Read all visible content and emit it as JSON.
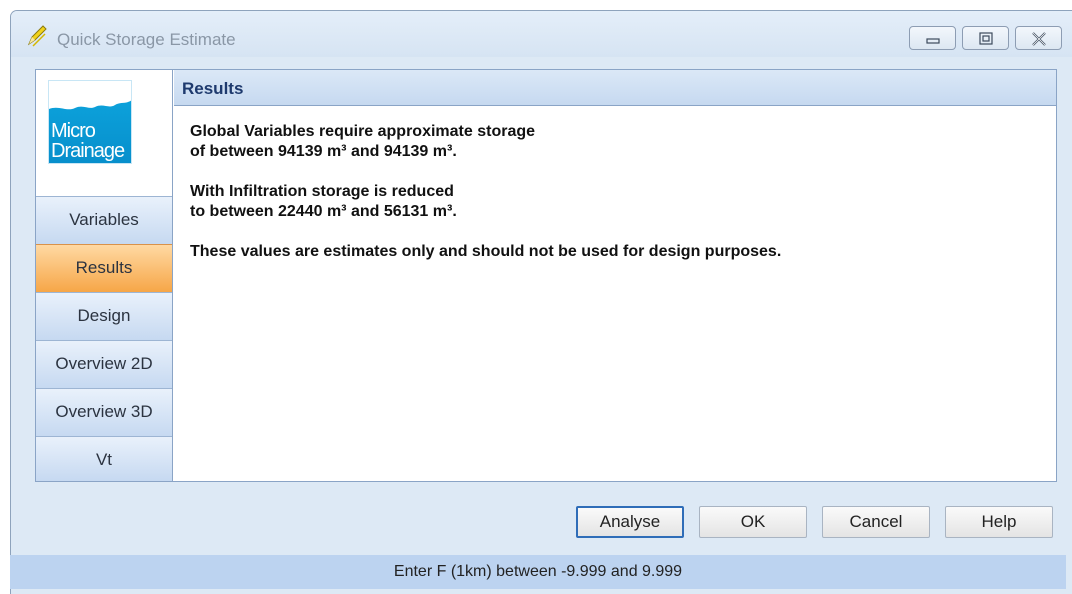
{
  "window": {
    "title": "Quick Storage Estimate"
  },
  "logo": {
    "line1": "Micro",
    "line2": "Drainage"
  },
  "sidebar": {
    "items": [
      {
        "label": "Variables",
        "active": false
      },
      {
        "label": "Results",
        "active": true
      },
      {
        "label": "Design",
        "active": false
      },
      {
        "label": "Overview 2D",
        "active": false
      },
      {
        "label": "Overview 3D",
        "active": false
      },
      {
        "label": "Vt",
        "active": false
      }
    ]
  },
  "content": {
    "header": "Results",
    "paragraphs": [
      {
        "line1": "Global Variables require approximate storage",
        "line2": "of between 94139 m³ and 94139 m³."
      },
      {
        "line1": "With Infiltration storage is reduced",
        "line2": "to between 22440 m³ and 56131 m³."
      },
      {
        "line1": "These values are estimates only and should not be used for design purposes."
      }
    ]
  },
  "buttons": {
    "analyse": "Analyse",
    "ok": "OK",
    "cancel": "Cancel",
    "help": "Help"
  },
  "status": {
    "text": "Enter F (1km) between -9.999 and 9.999"
  },
  "colors": {
    "active_nav": "#f6a647",
    "header_text": "#1e3a6e",
    "status_bg": "#bcd3f0"
  }
}
